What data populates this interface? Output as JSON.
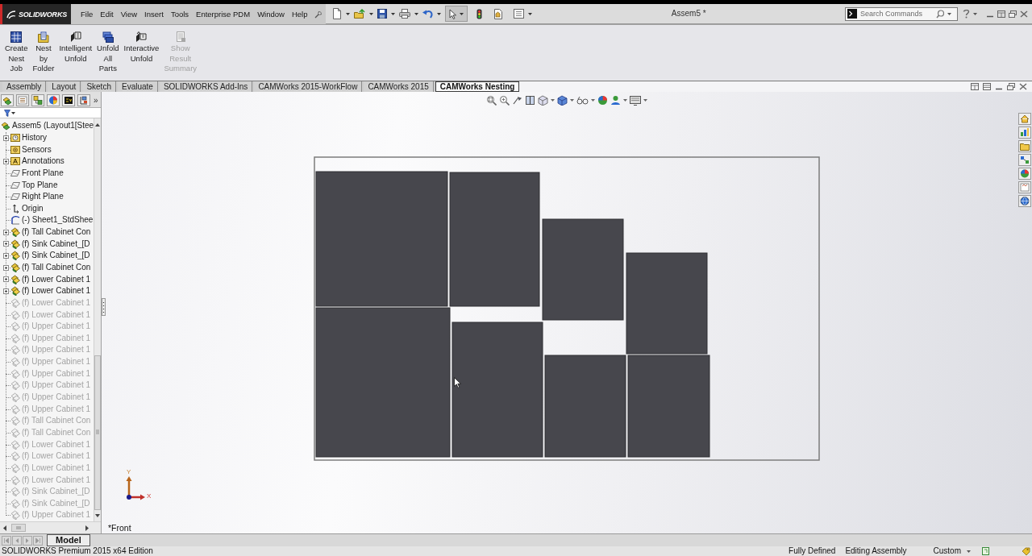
{
  "app": {
    "logo": "SOLIDWORKS",
    "title": "Assem5 *"
  },
  "menu": [
    "File",
    "Edit",
    "View",
    "Insert",
    "Tools",
    "Enterprise PDM",
    "Window",
    "Help"
  ],
  "search": {
    "placeholder": "Search Commands"
  },
  "ribbon": [
    {
      "label": "Create Nest Job",
      "disabled": false
    },
    {
      "label": "Nest by Folder",
      "disabled": false
    },
    {
      "label": "Intelligent Unfold",
      "disabled": false
    },
    {
      "label": "Unfold All Parts",
      "disabled": false
    },
    {
      "label": "Interactive Unfold",
      "disabled": false
    },
    {
      "label": "Show Result Summary",
      "disabled": true
    }
  ],
  "tabs": [
    {
      "label": "Assembly",
      "selected": false
    },
    {
      "label": "Layout",
      "selected": false
    },
    {
      "label": "Sketch",
      "selected": false
    },
    {
      "label": "Evaluate",
      "selected": false
    },
    {
      "label": "SOLIDWORKS Add-Ins",
      "selected": false
    },
    {
      "label": "CAMWorks 2015-WorkFlow",
      "selected": false
    },
    {
      "label": "CAMWorks 2015",
      "selected": false
    },
    {
      "label": "CAMWorks Nesting",
      "selected": true
    }
  ],
  "panel": {
    "more": "»",
    "tree": {
      "label": "Assem5 (Layout1[Stee",
      "kind": "assembly",
      "children": [
        {
          "label": "History",
          "kind": "history",
          "expandable": true,
          "dimmed": false
        },
        {
          "label": "Sensors",
          "kind": "sensors",
          "expandable": false,
          "dimmed": false
        },
        {
          "label": "Annotations",
          "kind": "annotations",
          "expandable": true,
          "dimmed": false
        },
        {
          "label": "Front Plane",
          "kind": "plane",
          "expandable": false,
          "dimmed": false
        },
        {
          "label": "Top Plane",
          "kind": "plane",
          "expandable": false,
          "dimmed": false
        },
        {
          "label": "Right Plane",
          "kind": "plane",
          "expandable": false,
          "dimmed": false
        },
        {
          "label": "Origin",
          "kind": "origin",
          "expandable": false,
          "dimmed": false
        },
        {
          "label": "(-) Sheet1_StdShee",
          "kind": "sketch",
          "expandable": false,
          "dimmed": false
        },
        {
          "label": "(f) Tall Cabinet Con",
          "kind": "component",
          "expandable": true,
          "dimmed": false
        },
        {
          "label": "(f) Sink Cabinet_[D",
          "kind": "component",
          "expandable": true,
          "dimmed": false
        },
        {
          "label": "(f) Sink Cabinet_[D",
          "kind": "component",
          "expandable": true,
          "dimmed": false
        },
        {
          "label": "(f) Tall Cabinet Con",
          "kind": "component",
          "expandable": true,
          "dimmed": false
        },
        {
          "label": "(f) Lower Cabinet 1",
          "kind": "component",
          "expandable": true,
          "dimmed": false
        },
        {
          "label": "(f) Lower Cabinet 1",
          "kind": "component",
          "expandable": true,
          "dimmed": false
        },
        {
          "label": "(f) Lower Cabinet 1",
          "kind": "component",
          "expandable": false,
          "dimmed": true
        },
        {
          "label": "(f) Lower Cabinet 1",
          "kind": "component",
          "expandable": false,
          "dimmed": true
        },
        {
          "label": "(f) Upper Cabinet 1",
          "kind": "component",
          "expandable": false,
          "dimmed": true
        },
        {
          "label": "(f) Upper Cabinet 1",
          "kind": "component",
          "expandable": false,
          "dimmed": true
        },
        {
          "label": "(f) Upper Cabinet 1",
          "kind": "component",
          "expandable": false,
          "dimmed": true
        },
        {
          "label": "(f) Upper Cabinet 1",
          "kind": "component",
          "expandable": false,
          "dimmed": true
        },
        {
          "label": "(f) Upper Cabinet 1",
          "kind": "component",
          "expandable": false,
          "dimmed": true
        },
        {
          "label": "(f) Upper Cabinet 1",
          "kind": "component",
          "expandable": false,
          "dimmed": true
        },
        {
          "label": "(f) Upper Cabinet 1",
          "kind": "component",
          "expandable": false,
          "dimmed": true
        },
        {
          "label": "(f) Upper Cabinet 1",
          "kind": "component",
          "expandable": false,
          "dimmed": true
        },
        {
          "label": "(f) Tall Cabinet Con",
          "kind": "component",
          "expandable": false,
          "dimmed": true
        },
        {
          "label": "(f) Tall Cabinet Con",
          "kind": "component",
          "expandable": false,
          "dimmed": true
        },
        {
          "label": "(f) Lower Cabinet 1",
          "kind": "component",
          "expandable": false,
          "dimmed": true
        },
        {
          "label": "(f) Lower Cabinet 1",
          "kind": "component",
          "expandable": false,
          "dimmed": true
        },
        {
          "label": "(f) Lower Cabinet 1",
          "kind": "component",
          "expandable": false,
          "dimmed": true
        },
        {
          "label": "(f) Lower Cabinet 1",
          "kind": "component",
          "expandable": false,
          "dimmed": true
        },
        {
          "label": "(f) Sink Cabinet_[D",
          "kind": "component",
          "expandable": false,
          "dimmed": true
        },
        {
          "label": "(f) Sink Cabinet_[D",
          "kind": "component",
          "expandable": false,
          "dimmed": true
        },
        {
          "label": "(f) Upper Cabinet 1",
          "kind": "component",
          "expandable": false,
          "dimmed": true
        }
      ]
    }
  },
  "viewport": {
    "view_name": "*Front",
    "triad": {
      "x_label": "X",
      "y_label": "Y"
    }
  },
  "bottom_tabs": [
    {
      "label": "Model",
      "selected": true
    }
  ],
  "status_bar": {
    "edition": "SOLIDWORKS Premium 2015 x64 Edition",
    "rebuild_state": "Fully Defined",
    "mode": "Editing Assembly",
    "units": "Custom"
  }
}
